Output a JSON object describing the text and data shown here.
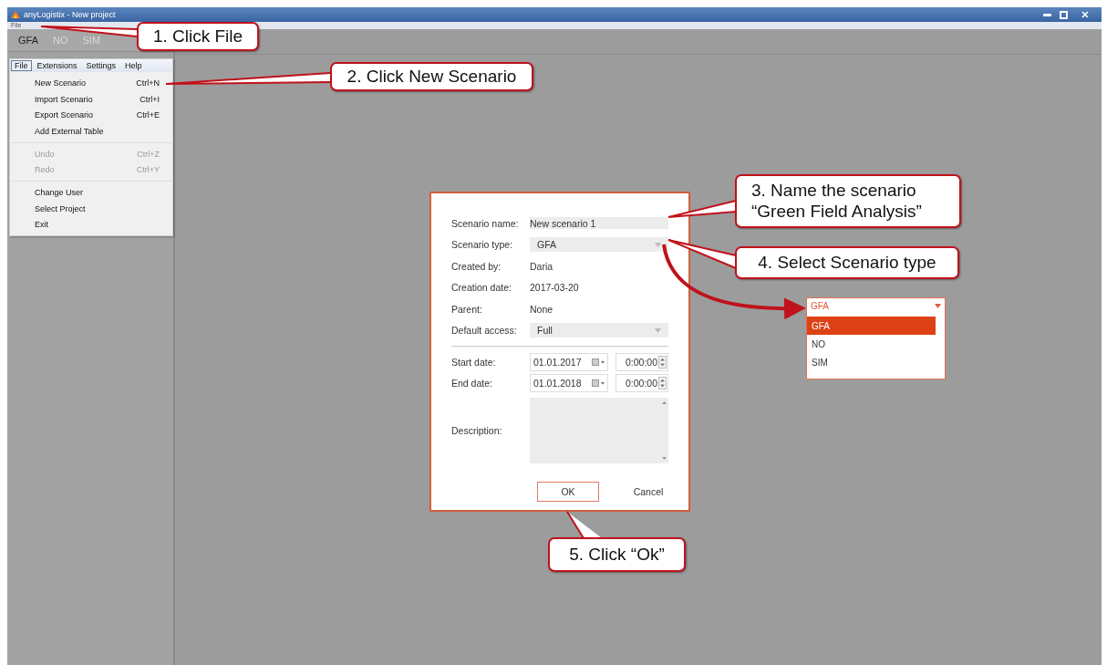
{
  "window": {
    "title": "anyLogistix - New project"
  },
  "menubar": [
    {
      "label": "File"
    }
  ],
  "toolbar_tabs": [
    {
      "label": "GFA",
      "selected": true
    },
    {
      "label": "NO",
      "selected": false
    },
    {
      "label": "SIM",
      "selected": false
    }
  ],
  "menu": {
    "bar": [
      {
        "label": "File",
        "selected": true
      },
      {
        "label": "Extensions",
        "selected": false
      },
      {
        "label": "Settings",
        "selected": false
      },
      {
        "label": "Help",
        "selected": false
      }
    ],
    "groups": [
      [
        {
          "label": "New Scenario",
          "shortcut": "Ctrl+N",
          "disabled": false
        },
        {
          "label": "Import Scenario",
          "shortcut": "Ctrl+I",
          "disabled": false
        },
        {
          "label": "Export Scenario",
          "shortcut": "Ctrl+E",
          "disabled": false
        },
        {
          "label": "Add External Table",
          "disabled": false
        }
      ],
      [
        {
          "label": "Undo",
          "shortcut": "Ctrl+Z",
          "disabled": true
        },
        {
          "label": "Redo",
          "shortcut": "Ctrl+Y",
          "disabled": true
        }
      ],
      [
        {
          "label": "Change User",
          "disabled": false
        },
        {
          "label": "Select Project",
          "disabled": false
        },
        {
          "label": "Exit",
          "disabled": false
        }
      ]
    ]
  },
  "dialog": {
    "fields": [
      {
        "kind": "text",
        "label": "Scenario name:",
        "value": "New scenario 1"
      },
      {
        "kind": "dropdown",
        "label": "Scenario type:",
        "value": "GFA"
      },
      {
        "kind": "static",
        "label": "Created by:",
        "value": "Daria"
      },
      {
        "kind": "static",
        "label": "Creation date:",
        "value": "2017-03-20"
      },
      {
        "kind": "static",
        "label": "Parent:",
        "value": "None"
      },
      {
        "kind": "dropdown",
        "label": "Default access:",
        "value": "Full"
      },
      {
        "kind": "separator"
      },
      {
        "kind": "datetime",
        "label": "Start date:",
        "date": "01.01.2017",
        "time": "0:00:00"
      },
      {
        "kind": "datetime",
        "label": "End date:",
        "date": "01.01.2018",
        "time": "0:00:00"
      },
      {
        "kind": "textarea",
        "label": "Description:"
      }
    ],
    "buttons": [
      {
        "label": "OK",
        "kind": "primary"
      },
      {
        "label": "Cancel",
        "kind": "plain"
      }
    ]
  },
  "type_popup": {
    "value": "GFA",
    "options": [
      {
        "label": "GFA",
        "selected": true
      },
      {
        "label": "NO",
        "selected": false
      },
      {
        "label": "SIM",
        "selected": false
      }
    ]
  },
  "callouts": [
    {
      "text": "1. Click File"
    },
    {
      "text": "2. Click New Scenario"
    },
    {
      "text": "3. Name the scenario\n“Green Field Analysis”"
    },
    {
      "text": "4. Select Scenario type"
    },
    {
      "text": "5. Click “Ok”"
    }
  ]
}
